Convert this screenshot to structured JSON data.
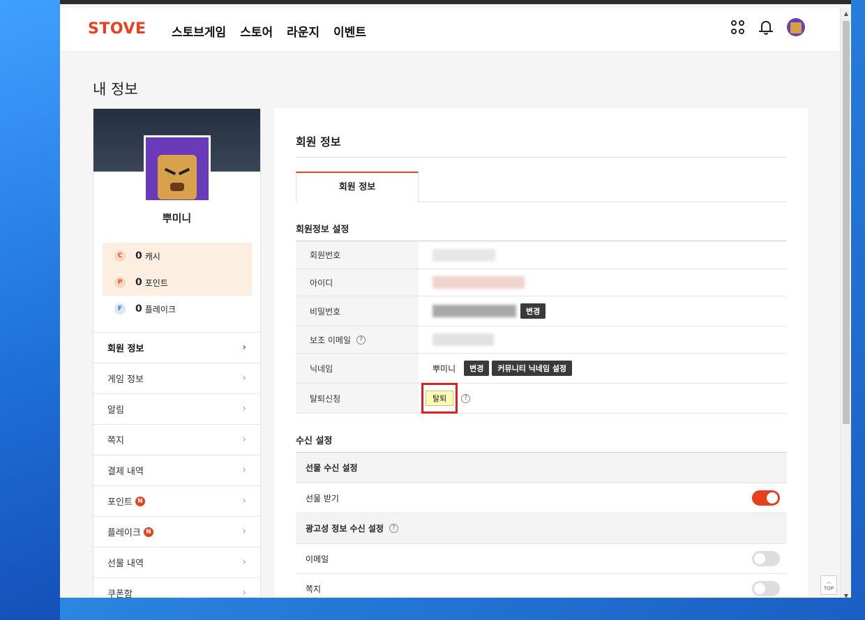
{
  "header": {
    "logo": "STOVE",
    "nav": [
      "스토브게임",
      "스토어",
      "라운지",
      "이벤트"
    ],
    "icons": [
      "apps-icon",
      "bell-icon",
      "avatar"
    ]
  },
  "page_title": "내 정보",
  "profile": {
    "nickname": "뿌미니",
    "wallet": [
      {
        "icon": "C",
        "amount": "0",
        "label": "캐시"
      },
      {
        "icon": "P",
        "amount": "0",
        "label": "포인트"
      },
      {
        "icon": "F",
        "amount": "0",
        "label": "플레이크"
      }
    ]
  },
  "menu": [
    {
      "label": "회원 정보",
      "badge": ""
    },
    {
      "label": "게임 정보",
      "badge": ""
    },
    {
      "label": "알림",
      "badge": ""
    },
    {
      "label": "쪽지",
      "badge": ""
    },
    {
      "label": "결제 내역",
      "badge": ""
    },
    {
      "label": "포인트",
      "badge": "N"
    },
    {
      "label": "플레이크",
      "badge": "N"
    },
    {
      "label": "선물 내역",
      "badge": ""
    },
    {
      "label": "쿠폰함",
      "badge": ""
    }
  ],
  "main": {
    "title": "회원 정보",
    "tab": "회원 정보",
    "section_member": "회원정보 설정",
    "rows": {
      "member_no": "회원번호",
      "id": "아이디",
      "password": "비밀번호",
      "backup_email": "보조 이메일",
      "nickname": "닉네임",
      "withdraw": "탈퇴신청"
    },
    "nickname_value": "뿌미니",
    "change_label": "변경",
    "community_nick_label": "커뮤니티 닉네임 설정",
    "withdraw_label": "탈퇴",
    "section_receive": "수신 설정",
    "gift_head": "선물 수신 설정",
    "gift_receive": "선물 받기",
    "ad_head": "광고성 정보 수신 설정",
    "email": "이메일",
    "message": "쪽지",
    "top_label": "TOP"
  }
}
